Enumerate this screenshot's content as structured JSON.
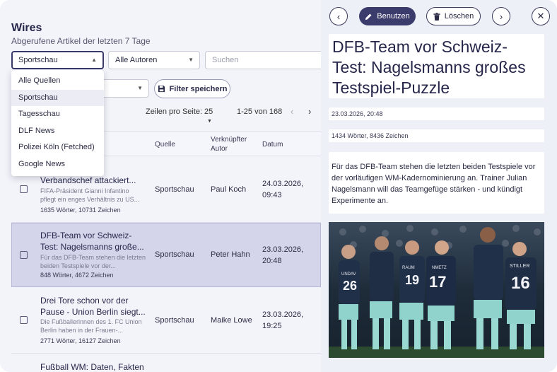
{
  "wires": {
    "title": "Wires",
    "subtitle": "Abgerufene Artikel der letzten 7 Tage"
  },
  "filters": {
    "source_selected": "Sportschau",
    "author_selected": "Alle Autoren",
    "search_placeholder": "Suchen",
    "save_filter_label": "Filter speichern"
  },
  "source_menu": {
    "items": [
      "Alle Quellen",
      "Sportschau",
      "Tagesschau",
      "DLF News",
      "Polizei Köln (Fetched)",
      "Google News"
    ],
    "active_index": 1
  },
  "pagination": {
    "rows_per_page_label": "Zeilen pro Seite:",
    "rows_per_page_value": "25",
    "range_text": "1-25 von 168"
  },
  "table": {
    "columns": [
      "Quelle",
      "Verknüpfter Autor",
      "Datum"
    ],
    "rows": [
      {
        "title": "Verbandschef attackiert...",
        "snippet": "FIFA-Präsident Gianni Infantino pflegt ein enges Verhältnis zu US...",
        "meta": "1635 Wörter, 10731 Zeichen",
        "source": "Sportschau",
        "author": "Paul Koch",
        "date": "24.03.2026,",
        "time": "09:43",
        "selected": false
      },
      {
        "title": "DFB-Team vor Schweiz-Test: Nagelsmanns große...",
        "snippet": "Für das DFB-Team stehen die letzten beiden Testspiele vor der...",
        "meta": "848 Wörter, 4672 Zeichen",
        "source": "Sportschau",
        "author": "Peter Hahn",
        "date": "23.03.2026,",
        "time": "20:48",
        "selected": true
      },
      {
        "title": "Drei Tore schon vor der Pause - Union Berlin siegt...",
        "snippet": "Die Fußballerinnen des 1. FC Union Berlin haben in der Frauen-...",
        "meta": "2771 Wörter, 16127 Zeichen",
        "source": "Sportschau",
        "author": "Maike Lowe",
        "date": "23.03.2026,",
        "time": "19:25",
        "selected": false
      },
      {
        "title": "Fußball WM: Daten, Fakten",
        "selected": false
      }
    ]
  },
  "detail": {
    "use_label": "Benutzen",
    "delete_label": "Löschen",
    "headline": "DFB-Team vor Schweiz-Test: Nagelsmanns großes Testspiel-Puzzle",
    "date": "23.03.2026, 20:48",
    "stats": "1434 Wörter, 8436 Zeichen",
    "body": "Für das DFB-Team stehen die letzten beiden Testspiele vor der vorläufigen WM-Kadernominierung an. Trainer Julian Nagelsmann will das Teamgefüge stärken - und kündigt Experimente an.",
    "jersey_names": [
      "UNDAV",
      "RAUM",
      "NMETZ",
      "STILLER"
    ],
    "jersey_numbers": [
      "26",
      "19",
      "17",
      "16"
    ]
  },
  "colors": {
    "accent": "#3b3b6c",
    "selected_row": "#d4d5ea",
    "background": "#eef0f8"
  }
}
